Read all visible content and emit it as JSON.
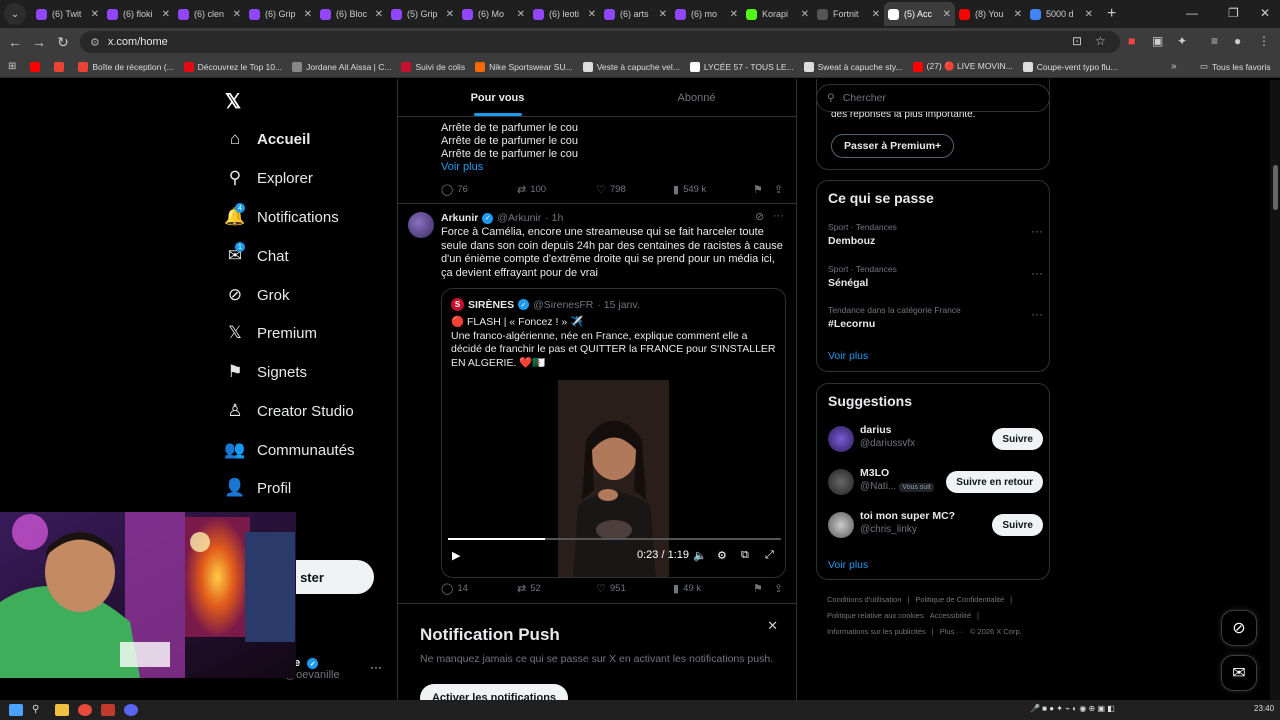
{
  "browser": {
    "tabs": [
      {
        "label": "(6) Twit",
        "color": "#9146ff"
      },
      {
        "label": "(6) floki",
        "color": "#9146ff"
      },
      {
        "label": "(6) clen",
        "color": "#9146ff"
      },
      {
        "label": "(6) Grip",
        "color": "#9146ff"
      },
      {
        "label": "(6) Bloc",
        "color": "#9146ff"
      },
      {
        "label": "(5) Grip",
        "color": "#9146ff"
      },
      {
        "label": "(6) Mo",
        "color": "#9146ff"
      },
      {
        "label": "(6) leoti",
        "color": "#9146ff"
      },
      {
        "label": "(6) arts",
        "color": "#9146ff"
      },
      {
        "label": "(6) mo",
        "color": "#9146ff"
      },
      {
        "label": "Korapi",
        "color": "#53fc18"
      },
      {
        "label": "Fortnit",
        "color": "#555555"
      },
      {
        "label": "(5) Acc",
        "color": "#ffffff"
      },
      {
        "label": "(8) You",
        "color": "#ff0000"
      },
      {
        "label": "5000 d",
        "color": "#4285f4"
      }
    ],
    "active_tab": 12,
    "url": "x.com/home",
    "bookmarks": [
      {
        "label": "",
        "color": "#ff0000"
      },
      {
        "label": "",
        "color": "#ea4335"
      },
      {
        "label": "Boîte de réception (...",
        "color": "#ea4335"
      },
      {
        "label": "Découvrez le Top 10...",
        "color": "#e50914"
      },
      {
        "label": "Jordane Ait Aissa | C...",
        "color": "#888888"
      },
      {
        "label": "Suivi de colis",
        "color": "#c8102e"
      },
      {
        "label": "Nike Sportswear SU...",
        "color": "#ff6900"
      },
      {
        "label": "Veste à capuche vel...",
        "color": "#dddddd"
      },
      {
        "label": "LYCÉE 57 - TOUS LE...",
        "color": "#ffffff"
      },
      {
        "label": "Sweat à capuche sty...",
        "color": "#dddddd"
      },
      {
        "label": "(27) 🔴 LIVE MOVIN...",
        "color": "#ff0000"
      },
      {
        "label": "Coupe-vent typo flu...",
        "color": "#dddddd"
      }
    ],
    "all_bookmarks": "Tous les favoris"
  },
  "nav": {
    "items": [
      {
        "label": "Accueil",
        "icon": "home-icon",
        "glyph": "⌂",
        "bold": true
      },
      {
        "label": "Explorer",
        "icon": "search-icon",
        "glyph": "⚲"
      },
      {
        "label": "Notifications",
        "icon": "bell-icon",
        "glyph": "🔔",
        "badge": "4"
      },
      {
        "label": "Chat",
        "icon": "mail-icon",
        "glyph": "✉",
        "badge": "1"
      },
      {
        "label": "Grok",
        "icon": "grok-icon",
        "glyph": "⊘"
      },
      {
        "label": "Premium",
        "icon": "x-icon",
        "glyph": "𝕏"
      },
      {
        "label": "Signets",
        "icon": "bookmark-icon",
        "glyph": "⚑"
      },
      {
        "label": "Creator Studio",
        "icon": "creator-icon",
        "glyph": "♙"
      },
      {
        "label": "Communautés",
        "icon": "communities-icon",
        "glyph": "👥"
      },
      {
        "label": "Profil",
        "icon": "profile-icon",
        "glyph": "👤"
      }
    ],
    "post_button": "ster",
    "account_name": "ille",
    "account_handle": "@oevanille"
  },
  "feed": {
    "tabs": [
      "Pour vous",
      "Abonné"
    ],
    "prev_tweet": {
      "lines": [
        "Arrête de te parfumer le cou",
        "Arrête de te parfumer le cou",
        "Arrête de te parfumer le cou",
        "Arrête de te"
      ],
      "more": "Voir plus",
      "replies": "76",
      "reposts": "100",
      "likes": "798",
      "views": "549 k"
    },
    "tweet": {
      "name": "Arkunir",
      "handle": "@Arkunir",
      "time": "· 1h",
      "text": "Force à Camélia, encore une streameuse qui se fait harceler toute seule dans son coin depuis 24h par des centaines de racistes à cause d'un énième compte d'extrême droite qui se prend pour un média ici, ça devient effrayant pour de vrai",
      "quote": {
        "name": "SIRÈNES",
        "handle": "@SirenesFR",
        "time": "· 15 janv.",
        "line1": "🔴 FLASH | « Foncez ! » ✈️",
        "text": "Une franco-algérienne, née en France, explique comment elle a décidé de franchir le pas et QUITTER la FRANCE pour S'INSTALLER EN ALGERIE. ❤️🇩🇿",
        "video_time": "0:23 / 1:19",
        "progress": 0.29
      },
      "replies": "14",
      "reposts": "52",
      "likes": "951",
      "views": "49 k"
    },
    "push": {
      "title": "Notification Push",
      "desc": "Ne manquez jamais ce qui se passe sur X en activant les notifications push.",
      "button": "Activer les notifications"
    }
  },
  "sidebar": {
    "search_placeholder": "Chercher",
    "premium_text": "des réponses la plus importante.",
    "premium_button": "Passer à Premium+",
    "trends_title": "Ce qui se passe",
    "trends": [
      {
        "category": "Sport · Tendances",
        "name": "Dembouz"
      },
      {
        "category": "Sport · Tendances",
        "name": "Sénégal"
      },
      {
        "category": "Tendance dans la catégorie France",
        "name": "#Lecornu"
      }
    ],
    "trends_more": "Voir plus",
    "suggestions_title": "Suggestions",
    "suggestions": [
      {
        "name": "darius",
        "handle": "@dariussvfx",
        "button": "Suivre",
        "color": "#5b3fa8"
      },
      {
        "name": "M3LO",
        "handle": "@Nati...",
        "follows_you": "Vous suit",
        "button": "Suivre en retour",
        "color": "#444444"
      },
      {
        "name": "toi mon super MC?",
        "handle": "@chris_linky",
        "button": "Suivre",
        "color": "#8a8a8a"
      }
    ],
    "suggestions_more": "Voir plus",
    "footer": [
      "Conditions d'utilisation",
      "Politique de Confidentialité",
      "Politique relative aux cookies",
      "Accessibilité",
      "Informations sur les publicités",
      "Plus ···",
      "© 2026 X Corp."
    ]
  },
  "taskbar": {
    "time": "23:40"
  }
}
